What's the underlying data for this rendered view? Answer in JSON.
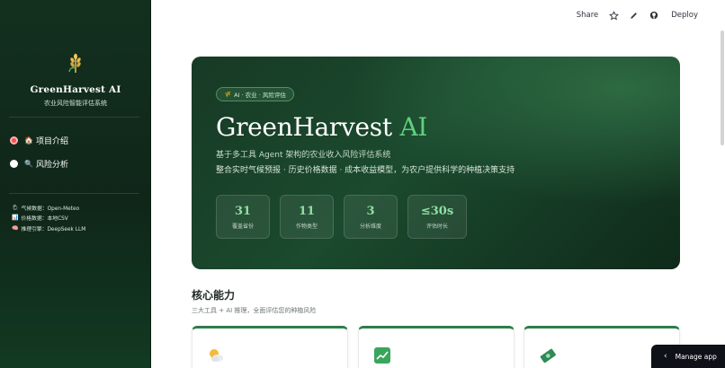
{
  "sidebar": {
    "brand_title": "GreenHarvest AI",
    "brand_subtitle": "农业风险智能评估系统",
    "nav": [
      {
        "emoji": "🏠",
        "label": "项目介绍",
        "selected": true
      },
      {
        "emoji": "🔍",
        "label": "风险分析",
        "selected": false
      }
    ],
    "sources": [
      {
        "icon": "🌦",
        "text": "气候数据：Open-Meteo"
      },
      {
        "icon": "📊",
        "text": "价格数据：本地CSV"
      },
      {
        "icon": "🧠",
        "text": "推理引擎：DeepSeek LLM"
      }
    ]
  },
  "topbar": {
    "share": "Share",
    "deploy": "Deploy",
    "icons": [
      "star-icon",
      "edit-icon",
      "github-icon"
    ]
  },
  "hero": {
    "badge_icon": "🌾",
    "badge_text": "AI · 农业 · 风险评估",
    "title_main": "GreenHarvest ",
    "title_accent": "AI",
    "line1": "基于多工具 Agent 架构的农业收入风险评估系统",
    "line2": "整合实时气候预报 · 历史价格数据 · 成本收益模型，为农户提供科学的种植决策支持",
    "stats": [
      {
        "value": "31",
        "label": "覆盖省份"
      },
      {
        "value": "11",
        "label": "作物类型"
      },
      {
        "value": "3",
        "label": "分析维度"
      },
      {
        "value": "≤30s",
        "label": "评估时长"
      }
    ]
  },
  "core": {
    "title": "核心能力",
    "subtitle": "三大工具 + AI 推理，全面评估您的种植风险",
    "cards": [
      {
        "icon": "weather-icon"
      },
      {
        "icon": "chart-icon"
      },
      {
        "icon": "money-icon"
      }
    ]
  },
  "manage_app": "Manage app",
  "colors": {
    "accent": "#5fd07d",
    "sidebar_bg": "#13301f",
    "hero_bg": "#1b4a2e"
  }
}
